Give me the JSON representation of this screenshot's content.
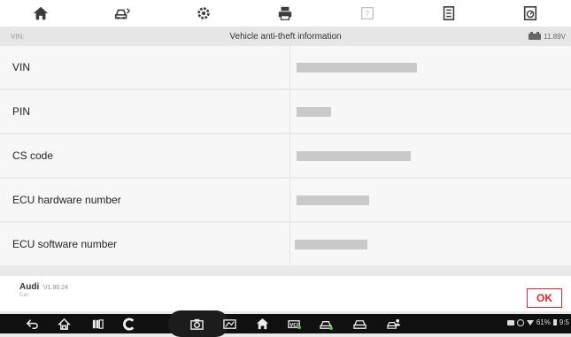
{
  "toolbar": {
    "items": [
      {
        "icon": "home-icon"
      },
      {
        "icon": "vehicle-swap-icon"
      },
      {
        "icon": "settings-gear-icon"
      },
      {
        "icon": "print-icon"
      },
      {
        "icon": "help-icon"
      },
      {
        "icon": "save-data-icon"
      },
      {
        "icon": "data-logging-icon"
      }
    ]
  },
  "status": {
    "vin_label": "VIN:",
    "title": "Vehicle anti-theft information",
    "voltage": "11.89V"
  },
  "rows": [
    {
      "label": "VIN"
    },
    {
      "label": "PIN"
    },
    {
      "label": "CS code"
    },
    {
      "label": "ECU hardware number"
    },
    {
      "label": "ECU software number"
    }
  ],
  "footer": {
    "make": "Audi",
    "version": "V1.90.24",
    "sub": "Car:",
    "ok_label": "OK"
  },
  "navbar": {
    "battery_percent": "61%",
    "time": "9:5"
  },
  "colors": {
    "accent": "#e0262a",
    "toolbar_icon": "#3c3c3c",
    "redaction": "#c9c9c9"
  }
}
